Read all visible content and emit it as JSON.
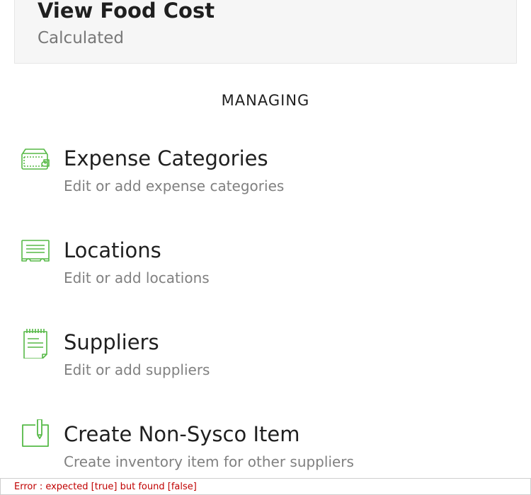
{
  "food_cost_card": {
    "title": "View Food Cost",
    "subtitle": "Calculated"
  },
  "managing": {
    "heading": "MANAGING",
    "items": [
      {
        "title": "Expense Categories",
        "description": "Edit or add expense categories",
        "icon": "wallet-icon"
      },
      {
        "title": "Locations",
        "description": "Edit or add locations",
        "icon": "location-storefront-icon"
      },
      {
        "title": "Suppliers",
        "description": "Edit or add suppliers",
        "icon": "notepad-icon"
      },
      {
        "title": "Create Non-Sysco Item",
        "description": "Create inventory item for other suppliers",
        "icon": "create-item-pen-icon"
      }
    ]
  },
  "error": {
    "message": "Error : expected [true] but found [false]"
  },
  "colors": {
    "accent_green": "#56b947",
    "error_red": "#c00000"
  }
}
